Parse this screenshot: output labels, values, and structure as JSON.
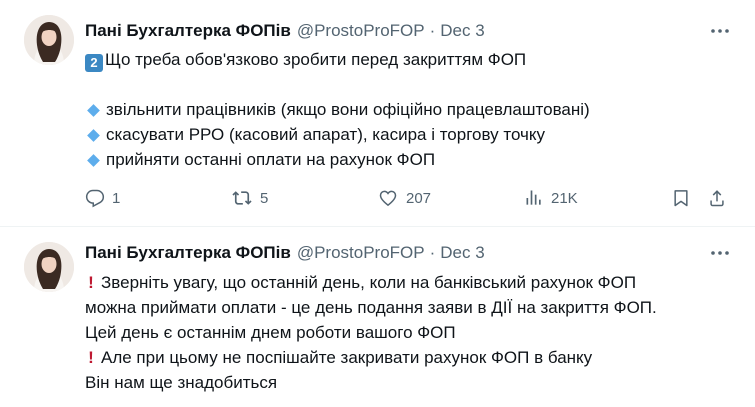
{
  "tweet1": {
    "author_name": "Пані Бухгалтерка ФОПів",
    "handle": "@ProstoProFOP",
    "separator": "·",
    "date": "Dec 3",
    "number_emoji": "2",
    "title": "Що треба обов'язково зробити перед закриттям ФОП",
    "bullets": [
      "звільнити працівників (якщо вони офіційно працевлаштовані)",
      "скасувати РРО (касовий апарат), касира і торгову точку",
      "прийняти останні оплати на рахунок ФОП"
    ],
    "actions": {
      "replies": "1",
      "reposts": "5",
      "likes": "207",
      "views": "21K"
    }
  },
  "tweet2": {
    "author_name": "Пані Бухгалтерка ФОПів",
    "handle": "@ProstoProFOP",
    "separator": "·",
    "date": "Dec 3",
    "lines": [
      "Зверніть увагу, що останній день, коли на банківський рахунок ФОП",
      "можна приймати оплати - це день подання заяви в ДІЇ на закриття ФОП.",
      "Цей день є останнім днем роботи вашого ФОП",
      "Але при цьому не поспішайте закривати рахунок ФОП в банку",
      "Він нам ще знадобиться"
    ],
    "exclamation": "❗"
  },
  "icons": [
    "more-icon",
    "reply-icon",
    "repost-icon",
    "like-icon",
    "views-icon",
    "bookmark-icon",
    "share-icon",
    "blue-diamond-icon",
    "keycap-two-icon",
    "red-exclamation-icon"
  ],
  "colors": {
    "text": "#0f1419",
    "muted": "#536471",
    "bullet": "#5dadec",
    "keycap": "#3b88c3",
    "exclamation": "#be1931"
  }
}
